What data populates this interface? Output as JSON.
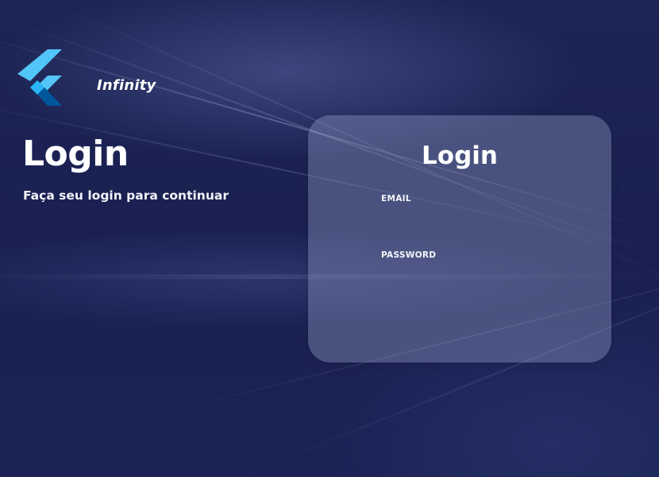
{
  "brand": {
    "name": "Infinity",
    "logo_colors": {
      "light": "#54c5f8",
      "mid": "#29b6f6",
      "dark": "#01579b"
    }
  },
  "hero": {
    "title": "Login",
    "subtitle": "Faça seu login para continuar"
  },
  "login_card": {
    "title": "Login",
    "email": {
      "label": "EMAIL",
      "value": "",
      "placeholder": ""
    },
    "password": {
      "label": "PASSWORD",
      "value": "",
      "placeholder": ""
    }
  },
  "theme": {
    "background": "#1a2152",
    "card_overlay": "rgba(150,160,200,0.38)",
    "text": "#ffffff"
  }
}
